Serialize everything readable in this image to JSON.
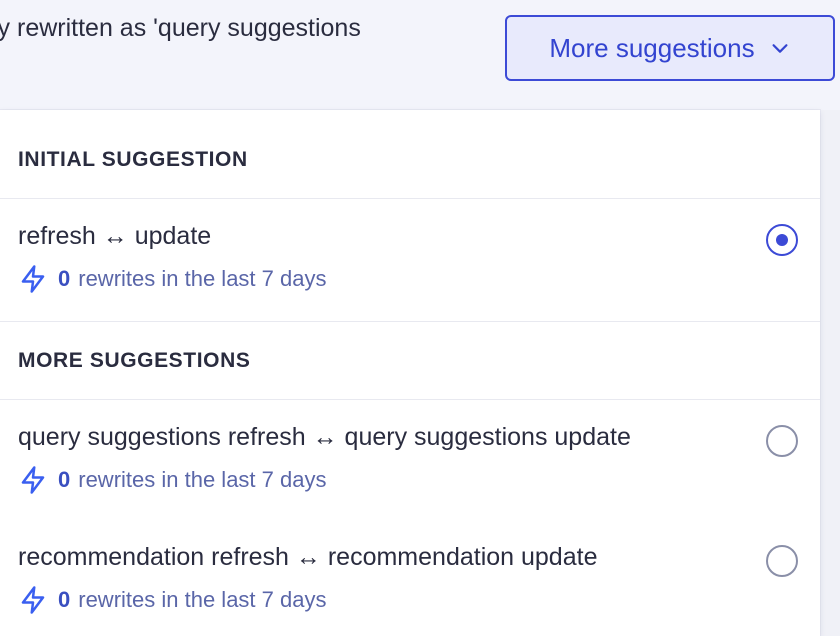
{
  "header": {
    "bg_text": "ly rewritten as 'query suggestions",
    "more_button_label": "More suggestions"
  },
  "sections": {
    "initial_heading": "INITIAL SUGGESTION",
    "more_heading": "MORE SUGGESTIONS"
  },
  "options": [
    {
      "title": "refresh ↔ update",
      "count": "0",
      "meta": "rewrites in the last 7 days",
      "selected": true
    },
    {
      "title": "query suggestions refresh ↔ query suggestions update",
      "count": "0",
      "meta": "rewrites in the last 7 days",
      "selected": false
    },
    {
      "title": "recommendation refresh ↔ recommendation update",
      "count": "0",
      "meta": "rewrites in the last 7 days",
      "selected": false
    }
  ],
  "icons": {
    "bolt": "lightning-bolt-icon",
    "chevron": "chevron-down-icon"
  },
  "colors": {
    "accent": "#3c4ad6",
    "meta_text": "#5a66a8",
    "bolt": "#3a5ff0"
  }
}
